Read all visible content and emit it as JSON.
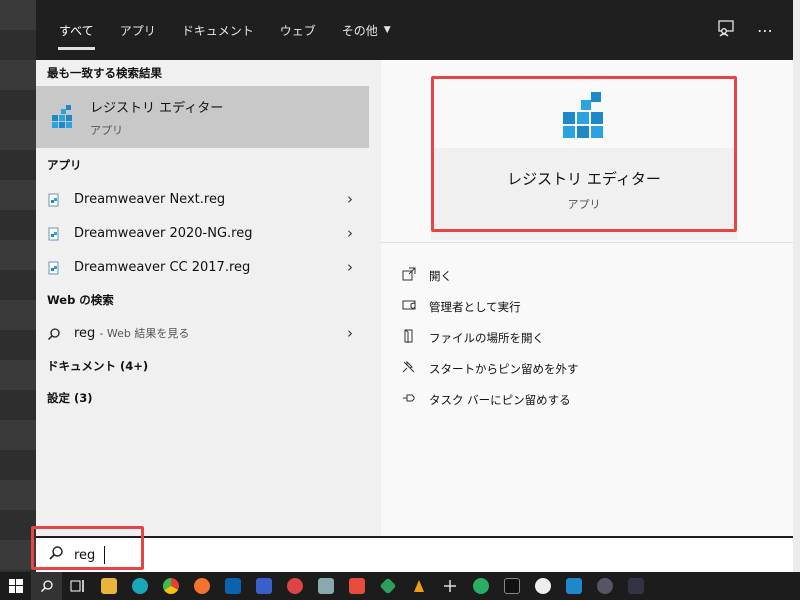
{
  "tabs": [
    {
      "label": "すべて"
    },
    {
      "label": "アプリ"
    },
    {
      "label": "ドキュメント"
    },
    {
      "label": "ウェブ"
    },
    {
      "label": "その他"
    }
  ],
  "best_match": {
    "heading": "最も一致する検索結果",
    "title": "レジストリ エディター",
    "subtitle": "アプリ"
  },
  "apps_section": {
    "heading": "アプリ",
    "items": [
      {
        "label": "Dreamweaver Next.reg"
      },
      {
        "label": "Dreamweaver 2020-NG.reg"
      },
      {
        "label": "Dreamweaver CC 2017.reg"
      }
    ]
  },
  "web_section": {
    "heading": "Web の検索",
    "query": "reg",
    "hint": "- Web 結果を見る"
  },
  "documents_heading": "ドキュメント (4+)",
  "settings_heading": "設定 (3)",
  "detail": {
    "title": "レジストリ エディター",
    "subtitle": "アプリ",
    "actions": [
      {
        "label": "開く",
        "icon": "open-icon"
      },
      {
        "label": "管理者として実行",
        "icon": "shield-icon"
      },
      {
        "label": "ファイルの場所を開く",
        "icon": "file-location-icon"
      },
      {
        "label": "スタートからピン留めを外す",
        "icon": "unpin-icon"
      },
      {
        "label": "タスク バーにピン留めする",
        "icon": "pin-icon"
      }
    ]
  },
  "search": {
    "value": "reg"
  },
  "colors": {
    "highlight": "#e64545",
    "topbar": "#1f1f1f",
    "selected_row": "#c8c8c8"
  }
}
